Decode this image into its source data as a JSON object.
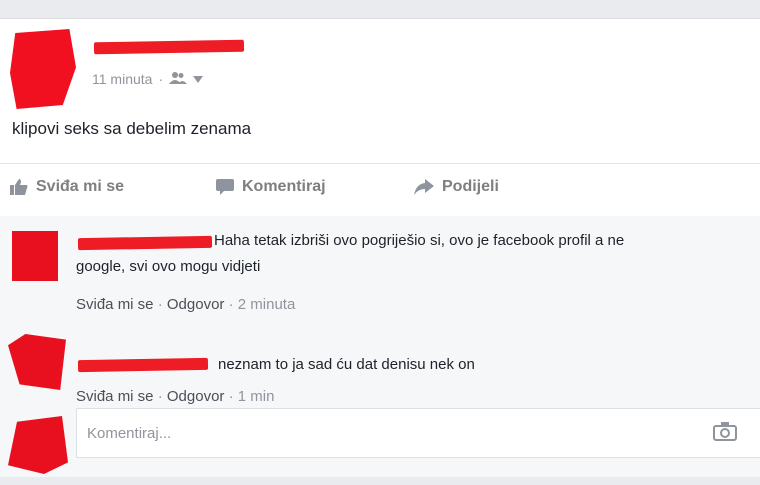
{
  "post": {
    "time": "11 minuta",
    "privacy_icon": "friends-icon",
    "text": "klipovi seks sa debelim zenama"
  },
  "actions": {
    "like": "Sviđa mi se",
    "comment": "Komentiraj",
    "share": "Podijeli"
  },
  "comments": [
    {
      "line1": "Haha tetak izbriši ovo pogriješio si, ovo je facebook profil a ne",
      "line2": "google, svi ovo mogu vidjeti",
      "like": "Sviđa mi se",
      "reply": "Odgovor",
      "time": "2 minuta"
    },
    {
      "line1": "neznam to ja sad ću dat denisu nek on",
      "like": "Sviđa mi se",
      "reply": "Odgovor",
      "time": "1 min"
    }
  ],
  "composer": {
    "placeholder": "Komentiraj..."
  },
  "colors": {
    "redaction": "#ee1c25",
    "meta": "#90949c",
    "text": "#1d2129"
  }
}
